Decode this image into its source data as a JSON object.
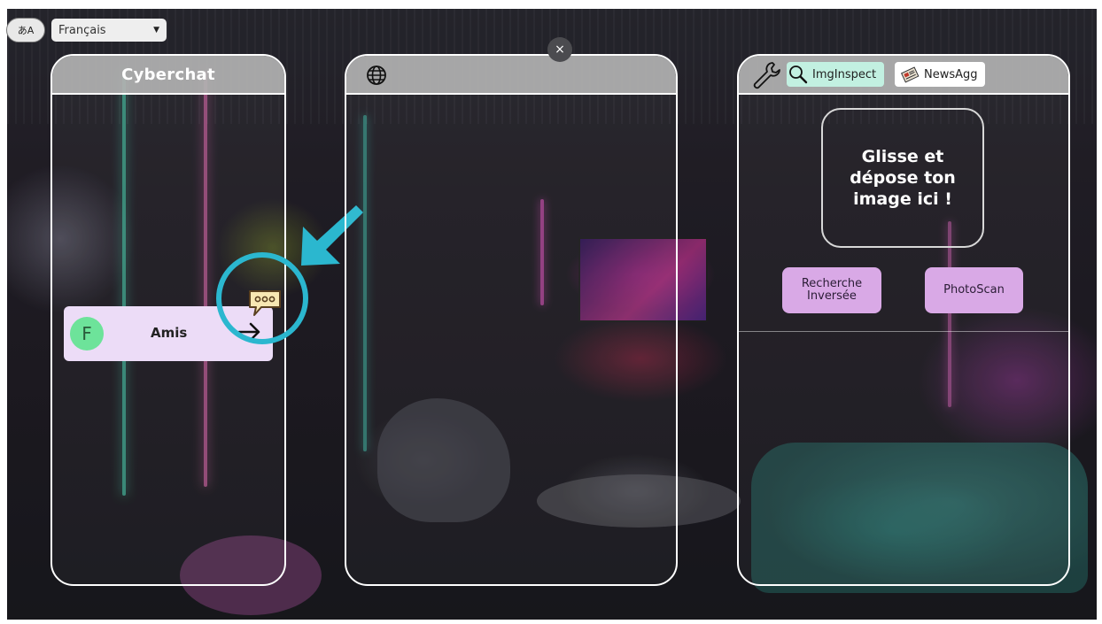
{
  "language": {
    "icon_text": "あA",
    "selected": "Français"
  },
  "close": {
    "symbol": "×"
  },
  "cyberchat": {
    "title": "Cyberchat",
    "friends": {
      "avatar_letter": "F",
      "label": "Amis"
    }
  },
  "browser": {
    "icon": "globe-icon"
  },
  "tools": {
    "tabs": [
      {
        "label": "ImgInspect",
        "icon": "magnifier-icon",
        "active": true
      },
      {
        "label": "NewsAgg",
        "icon": "newspaper-icon",
        "active": false
      }
    ],
    "dropzone": "Glisse et dépose ton image ici !",
    "buttons": {
      "reverse_search": "Recherche Inversée",
      "photoscan": "PhotoScan"
    }
  },
  "colors": {
    "highlight": "#2bb7cf",
    "active_tab": "#c2f0e1",
    "action_button": "#d9a9e6",
    "friend_row": "#ecdcf7",
    "avatar": "#6de39a"
  }
}
